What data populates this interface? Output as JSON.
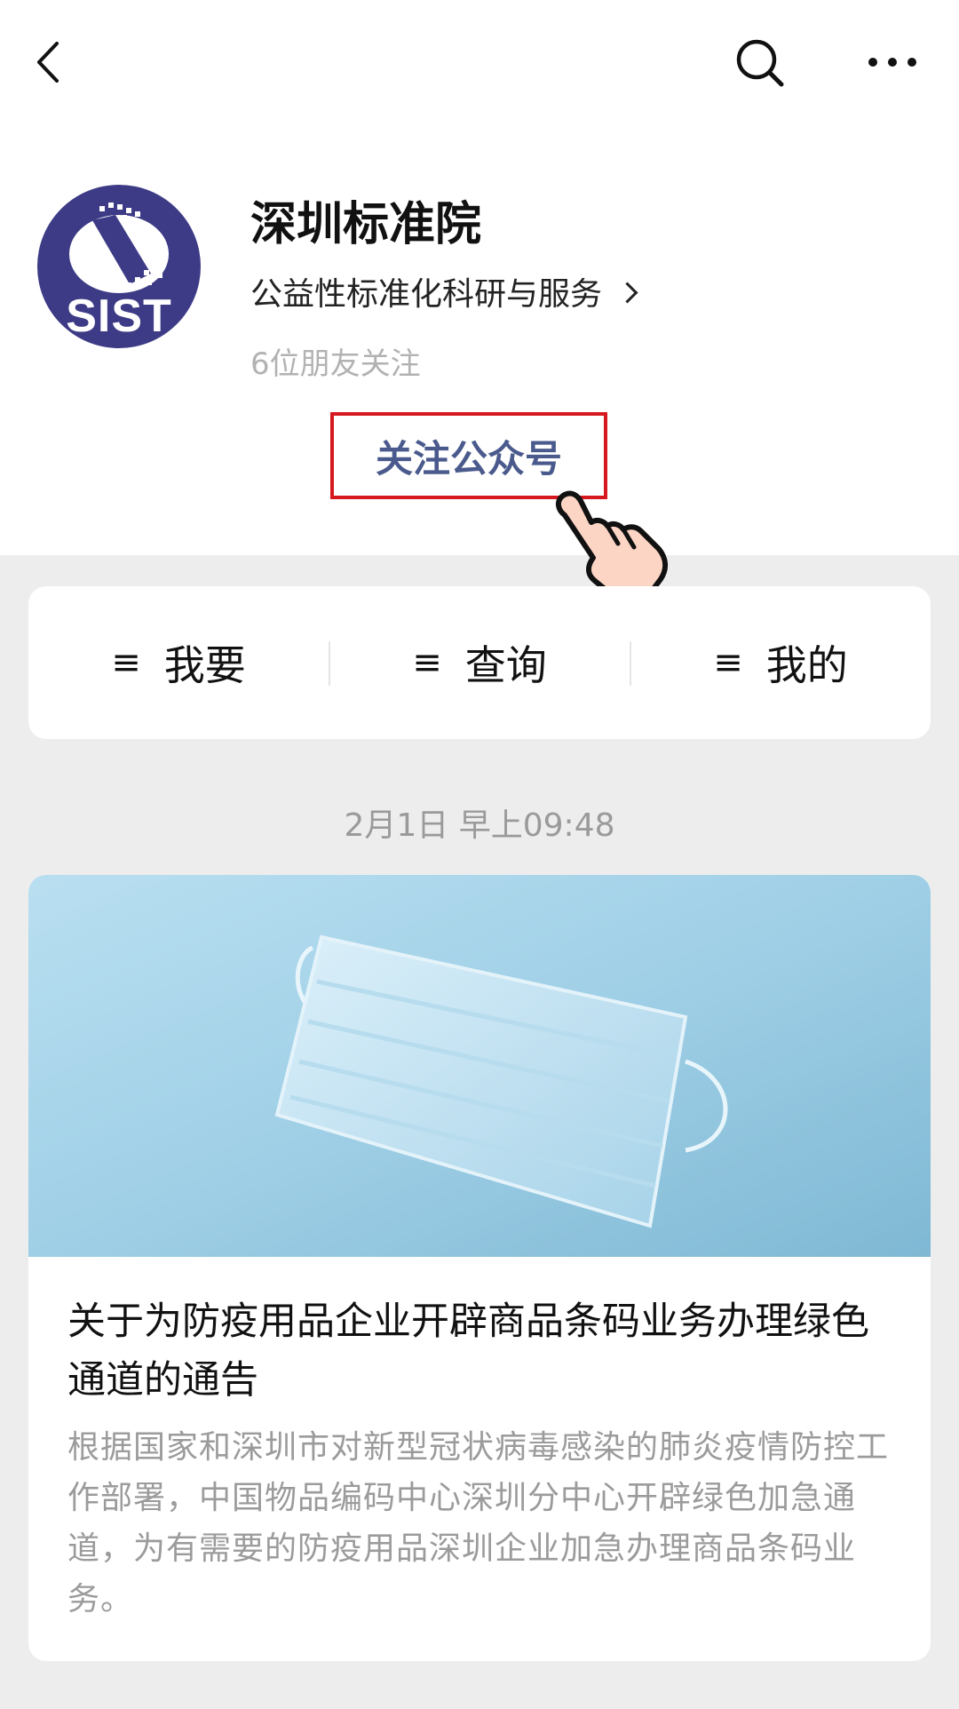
{
  "account": {
    "avatar_text": "SIST",
    "name": "深圳标准院",
    "description": "公益性标准化科研与服务",
    "friends_following": "6位朋友关注",
    "follow_button_label": "关注公众号"
  },
  "menu": [
    {
      "label": "我要"
    },
    {
      "label": "查询"
    },
    {
      "label": "我的"
    }
  ],
  "feed": {
    "timestamp": "2月1日 早上09:48",
    "article": {
      "title": "关于为防疫用品企业开辟商品条码业务办理绿色通道的通告",
      "summary": "根据国家和深圳市对新型冠状病毒感染的肺炎疫情防控工作部署，中国物品编码中心深圳分中心开辟绿色加急通道，为有需要的防疫用品深圳企业加急办理商品条码业务。"
    }
  },
  "colors": {
    "follow_border": "#d6191f",
    "follow_text": "#4a5a8c",
    "avatar_bg": "#3d3b86"
  }
}
